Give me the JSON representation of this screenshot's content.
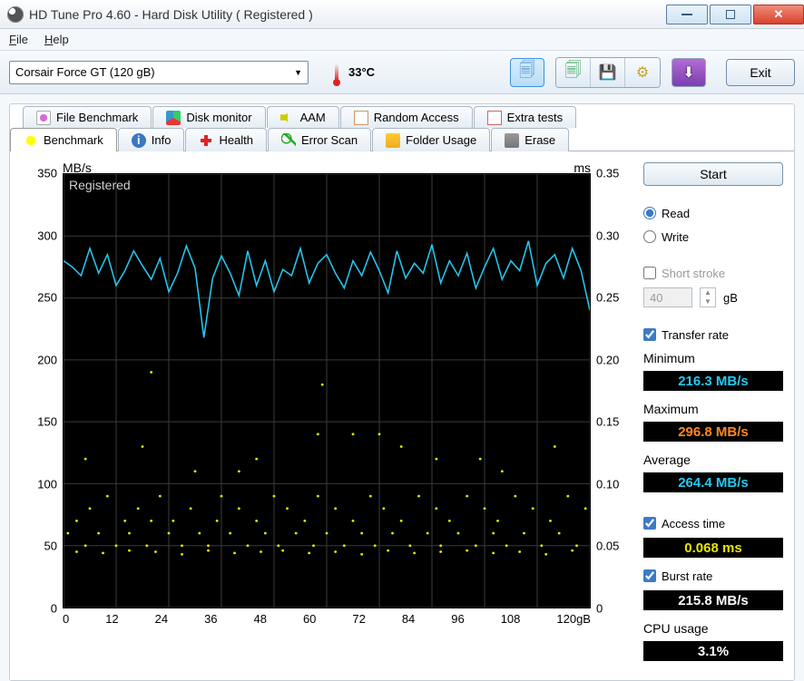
{
  "titlebar": {
    "title": "HD Tune Pro 4.60 - Hard Disk Utility (  Registered )"
  },
  "menu": {
    "file": "File",
    "help": "Help"
  },
  "toolbar": {
    "device": "Corsair Force GT       (120 gB)",
    "temperature": "33°C",
    "exit": "Exit"
  },
  "tabs": {
    "row1": [
      "File Benchmark",
      "Disk monitor",
      "AAM",
      "Random Access",
      "Extra tests"
    ],
    "row2": [
      "Benchmark",
      "Info",
      "Health",
      "Error Scan",
      "Folder Usage",
      "Erase"
    ]
  },
  "bench": {
    "start": "Start",
    "read": "Read",
    "write": "Write",
    "short_stroke": "Short stroke",
    "stroke_val": "40",
    "stroke_unit": "gB",
    "transfer_rate": "Transfer rate",
    "min_label": "Minimum",
    "min_value": "216.3 MB/s",
    "max_label": "Maximum",
    "max_value": "296.8 MB/s",
    "avg_label": "Average",
    "avg_value": "264.4 MB/s",
    "access_time": "Access time",
    "access_value": "0.068 ms",
    "burst_rate": "Burst rate",
    "burst_value": "215.8 MB/s",
    "cpu_label": "CPU usage",
    "cpu_value": "3.1%",
    "registered": "Registered"
  },
  "chart_data": {
    "type": "line",
    "title": "",
    "xlabel": "gB",
    "ylabel_left": "MB/s",
    "ylabel_right": "ms",
    "xlim": [
      0,
      120
    ],
    "y_left_lim": [
      0,
      350
    ],
    "y_right_lim": [
      0,
      0.35
    ],
    "y_left_ticks": [
      0,
      50,
      100,
      150,
      200,
      250,
      300,
      350
    ],
    "y_right_ticks": [
      0,
      0.05,
      0.1,
      0.15,
      0.2,
      0.25,
      0.3,
      0.35
    ],
    "x_ticks": [
      0,
      12,
      24,
      36,
      48,
      60,
      72,
      84,
      96,
      108,
      120
    ],
    "series": [
      {
        "name": "transfer_mb_s",
        "axis": "left",
        "x": [
          0,
          2,
          4,
          6,
          8,
          10,
          12,
          14,
          16,
          18,
          20,
          22,
          24,
          26,
          28,
          30,
          32,
          34,
          36,
          38,
          40,
          42,
          44,
          46,
          48,
          50,
          52,
          54,
          56,
          58,
          60,
          62,
          64,
          66,
          68,
          70,
          72,
          74,
          76,
          78,
          80,
          82,
          84,
          86,
          88,
          90,
          92,
          94,
          96,
          98,
          100,
          102,
          104,
          106,
          108,
          110,
          112,
          114,
          116,
          118,
          120
        ],
        "values": [
          280,
          275,
          268,
          290,
          270,
          285,
          260,
          272,
          288,
          276,
          265,
          282,
          255,
          270,
          292,
          274,
          218,
          266,
          284,
          270,
          252,
          288,
          260,
          280,
          255,
          273,
          268,
          290,
          262,
          278,
          285,
          270,
          258,
          280,
          268,
          287,
          272,
          254,
          288,
          266,
          278,
          270,
          293,
          262,
          280,
          268,
          286,
          258,
          275,
          290,
          265,
          280,
          272,
          296,
          260,
          278,
          285,
          266,
          290,
          272,
          240
        ]
      },
      {
        "name": "access_ms",
        "axis": "right",
        "type": "scatter",
        "x": [
          1,
          3,
          5,
          6,
          8,
          10,
          12,
          14,
          15,
          17,
          19,
          20,
          22,
          24,
          25,
          27,
          29,
          31,
          33,
          35,
          36,
          38,
          40,
          42,
          44,
          46,
          48,
          49,
          51,
          53,
          55,
          57,
          58,
          60,
          62,
          64,
          66,
          68,
          70,
          71,
          73,
          75,
          77,
          79,
          81,
          83,
          85,
          86,
          88,
          90,
          92,
          94,
          96,
          98,
          99,
          101,
          103,
          105,
          107,
          109,
          111,
          113,
          115,
          117,
          119,
          3,
          9,
          15,
          21,
          27,
          33,
          39,
          45,
          50,
          56,
          62,
          68,
          74,
          80,
          86,
          92,
          98,
          104,
          110,
          116,
          5,
          18,
          30,
          44,
          59,
          72,
          85,
          100,
          112,
          20,
          58,
          95,
          40,
          77,
          66
        ],
        "values": [
          0.06,
          0.07,
          0.05,
          0.08,
          0.06,
          0.09,
          0.05,
          0.07,
          0.06,
          0.08,
          0.05,
          0.07,
          0.09,
          0.06,
          0.07,
          0.05,
          0.08,
          0.06,
          0.05,
          0.07,
          0.09,
          0.06,
          0.08,
          0.05,
          0.07,
          0.06,
          0.09,
          0.05,
          0.08,
          0.06,
          0.07,
          0.05,
          0.09,
          0.06,
          0.08,
          0.05,
          0.07,
          0.06,
          0.09,
          0.05,
          0.08,
          0.06,
          0.07,
          0.05,
          0.09,
          0.06,
          0.08,
          0.05,
          0.07,
          0.06,
          0.09,
          0.05,
          0.08,
          0.06,
          0.07,
          0.05,
          0.09,
          0.06,
          0.08,
          0.05,
          0.07,
          0.06,
          0.09,
          0.05,
          0.08,
          0.045,
          0.044,
          0.046,
          0.045,
          0.043,
          0.046,
          0.044,
          0.045,
          0.046,
          0.044,
          0.045,
          0.043,
          0.046,
          0.044,
          0.045,
          0.046,
          0.044,
          0.045,
          0.043,
          0.046,
          0.12,
          0.13,
          0.11,
          0.12,
          0.18,
          0.14,
          0.12,
          0.11,
          0.13,
          0.19,
          0.14,
          0.12,
          0.11,
          0.13,
          0.14
        ]
      }
    ]
  }
}
